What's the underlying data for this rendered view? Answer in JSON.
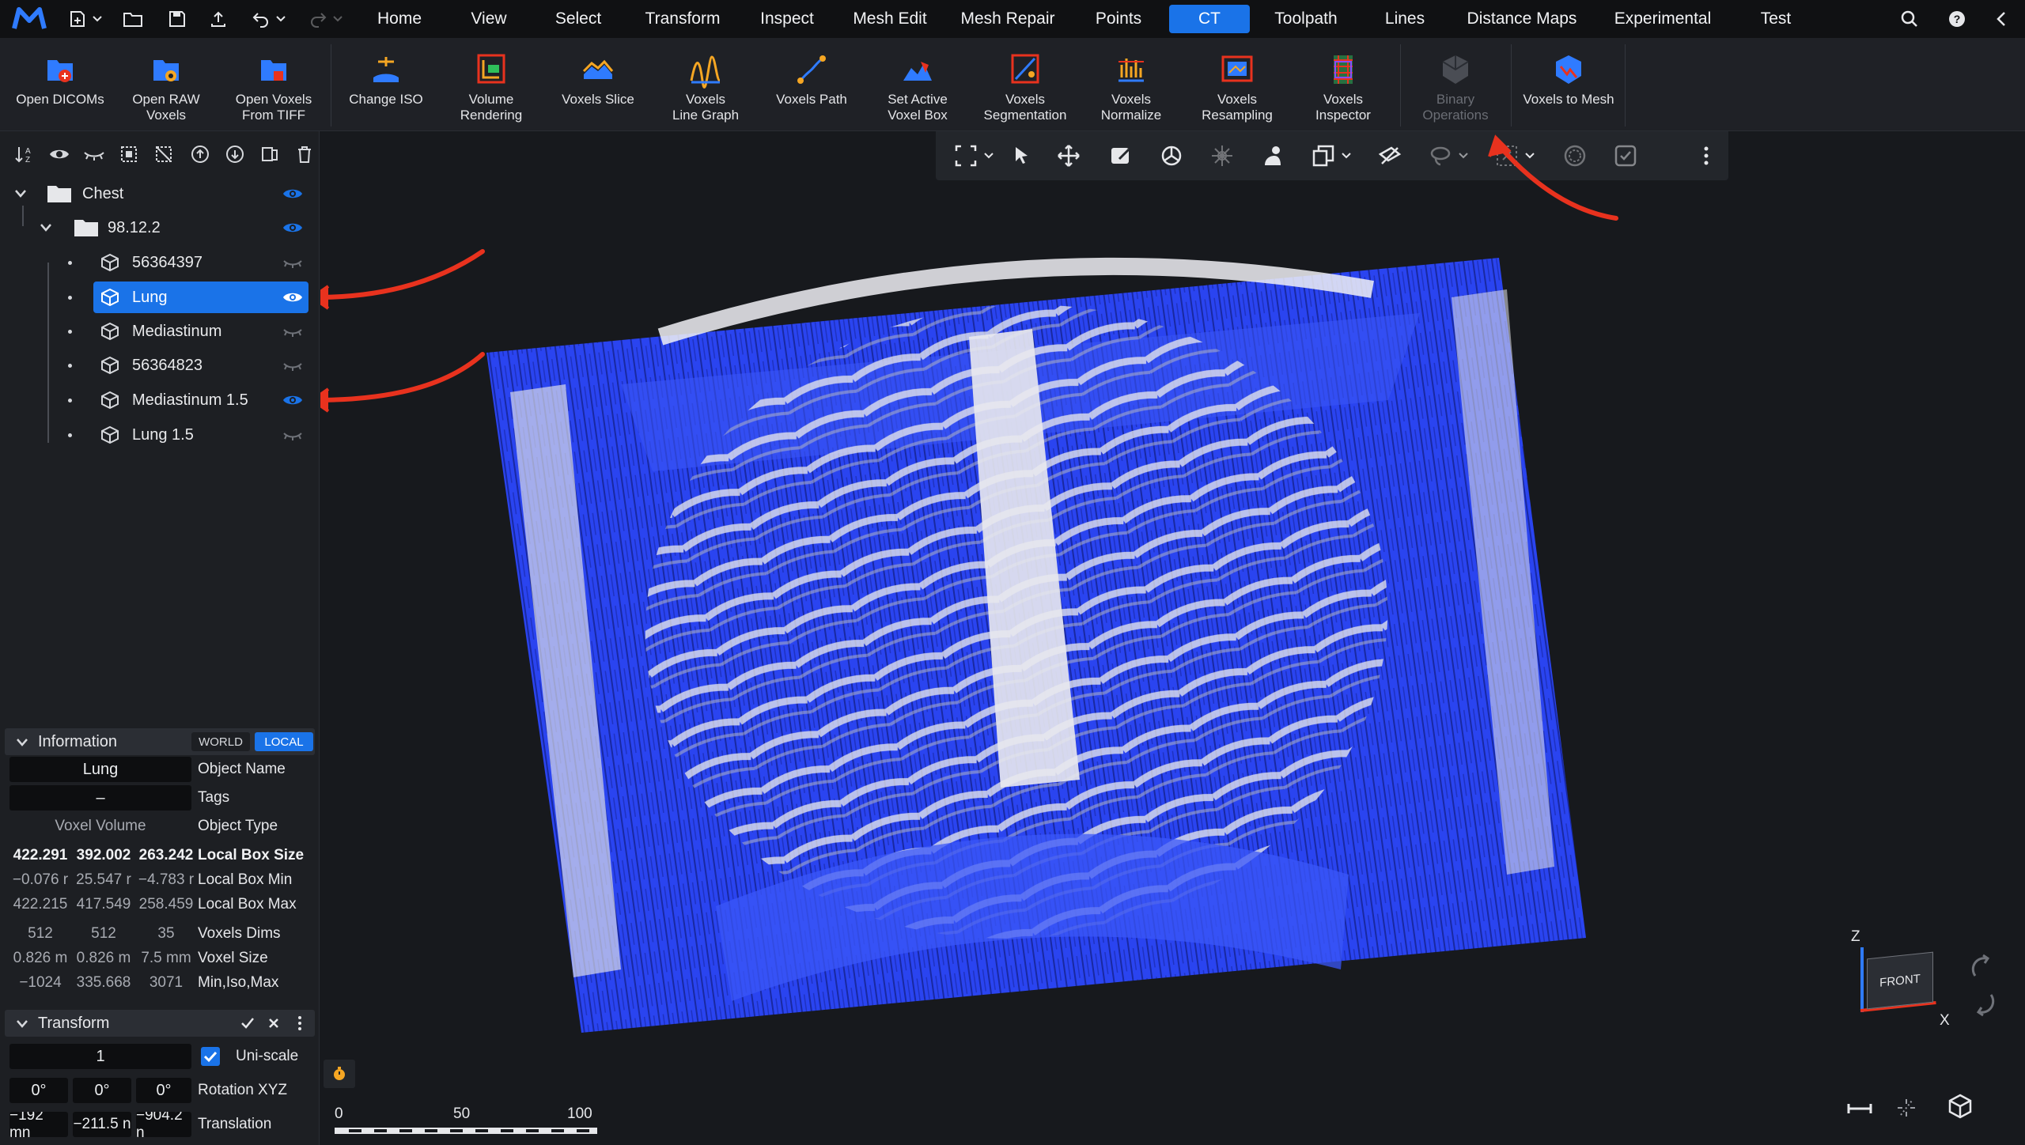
{
  "menu": {
    "tabs": [
      {
        "label": "Home",
        "active": false
      },
      {
        "label": "View",
        "active": false
      },
      {
        "label": "Select",
        "active": false
      },
      {
        "label": "Transform",
        "active": false
      },
      {
        "label": "Inspect",
        "active": false
      },
      {
        "label": "Mesh Edit",
        "active": false
      },
      {
        "label": "Mesh Repair",
        "active": false
      },
      {
        "label": "Points",
        "active": false
      },
      {
        "label": "CT",
        "active": true
      },
      {
        "label": "Toolpath",
        "active": false
      },
      {
        "label": "Lines",
        "active": false
      },
      {
        "label": "Distance Maps",
        "active": false
      },
      {
        "label": "Experimental",
        "active": false
      },
      {
        "label": "Test",
        "active": false
      }
    ]
  },
  "ribbon": {
    "buttons": [
      {
        "label": "Open DICOMs",
        "icon": "folder-plus-icon",
        "disabled": false
      },
      {
        "label": "Open RAW\nVoxels",
        "icon": "folder-gear-icon",
        "disabled": false
      },
      {
        "label": "Open Voxels\nFrom TIFF",
        "icon": "folder-tiff-icon",
        "disabled": false
      },
      {
        "label": "Change ISO",
        "icon": "iso-level-icon",
        "disabled": false
      },
      {
        "label": "Volume\nRendering",
        "icon": "volume-rendering-icon",
        "disabled": false
      },
      {
        "label": "Voxels Slice",
        "icon": "voxels-slice-icon",
        "disabled": false
      },
      {
        "label": "Voxels\nLine Graph",
        "icon": "line-graph-icon",
        "disabled": false
      },
      {
        "label": "Voxels Path",
        "icon": "voxels-path-icon",
        "disabled": false
      },
      {
        "label": "Set Active\nVoxel Box",
        "icon": "voxel-box-icon",
        "disabled": false
      },
      {
        "label": "Voxels\nSegmentation",
        "icon": "segmentation-icon",
        "disabled": false
      },
      {
        "label": "Voxels\nNormalize",
        "icon": "normalize-icon",
        "disabled": false
      },
      {
        "label": "Voxels\nResampling",
        "icon": "resampling-icon",
        "disabled": false
      },
      {
        "label": "Voxels\nInspector",
        "icon": "inspector-icon",
        "disabled": false
      },
      {
        "label": "Binary\nOperations",
        "icon": "binary-operations-icon",
        "disabled": true
      },
      {
        "label": "Voxels to Mesh",
        "icon": "voxels-to-mesh-icon",
        "disabled": false
      }
    ]
  },
  "scene": {
    "root": {
      "label": "Chest",
      "visible": true
    },
    "group": {
      "label": "98.12.2",
      "visible": true
    },
    "items": [
      {
        "label": "56364397",
        "visible": false,
        "selected": false
      },
      {
        "label": "Lung",
        "visible": true,
        "selected": true
      },
      {
        "label": "Mediastinum",
        "visible": false,
        "selected": false
      },
      {
        "label": "56364823",
        "visible": false,
        "selected": false
      },
      {
        "label": "Mediastinum 1.5",
        "visible": true,
        "selected": false
      },
      {
        "label": "Lung 1.5",
        "visible": false,
        "selected": false
      }
    ]
  },
  "information": {
    "title": "Information",
    "world": "WORLD",
    "local": "LOCAL",
    "object_name": {
      "value": "Lung",
      "label": "Object Name"
    },
    "tags": {
      "value": "–",
      "label": "Tags"
    },
    "object_type": {
      "value": "Voxel Volume",
      "label": "Object Type"
    },
    "box_size": {
      "values": [
        "422.291",
        "392.002",
        "263.242"
      ],
      "label": "Local Box Size"
    },
    "box_min": {
      "values": [
        "−0.076 r",
        "25.547 r",
        "−4.783 r"
      ],
      "label": "Local Box Min"
    },
    "box_max": {
      "values": [
        "422.215",
        "417.549",
        "258.459"
      ],
      "label": "Local Box Max"
    },
    "dims": {
      "values": [
        "512",
        "512",
        "35"
      ],
      "label": "Voxels Dims"
    },
    "voxel_size": {
      "values": [
        "0.826 m",
        "0.826 m",
        "7.5 mm"
      ],
      "label": "Voxel Size"
    },
    "min_iso_max": {
      "values": [
        "−1024",
        "335.668",
        "3071"
      ],
      "label": "Min,Iso,Max"
    }
  },
  "transform": {
    "title": "Transform",
    "scale_value": "1",
    "uniscale_label": "Uni-scale",
    "uniscale_checked": true,
    "rotation": {
      "values": [
        "0°",
        "0°",
        "0°"
      ],
      "label": "Rotation XYZ"
    },
    "translation": {
      "values": [
        "−192 mn",
        "−211.5 n",
        "−904.2 n"
      ],
      "label": "Translation"
    }
  },
  "viewport": {
    "scale_bar": {
      "ticks": [
        "0",
        "50",
        "100"
      ]
    },
    "view_cube": {
      "face": "FRONT",
      "axis_z": "Z",
      "axis_x": "X"
    }
  },
  "colors": {
    "accent": "#1a73e8",
    "voxel_blue": "#2a44f0",
    "bone": "#e7e7ea",
    "annotation_arrow": "#e8321e"
  }
}
